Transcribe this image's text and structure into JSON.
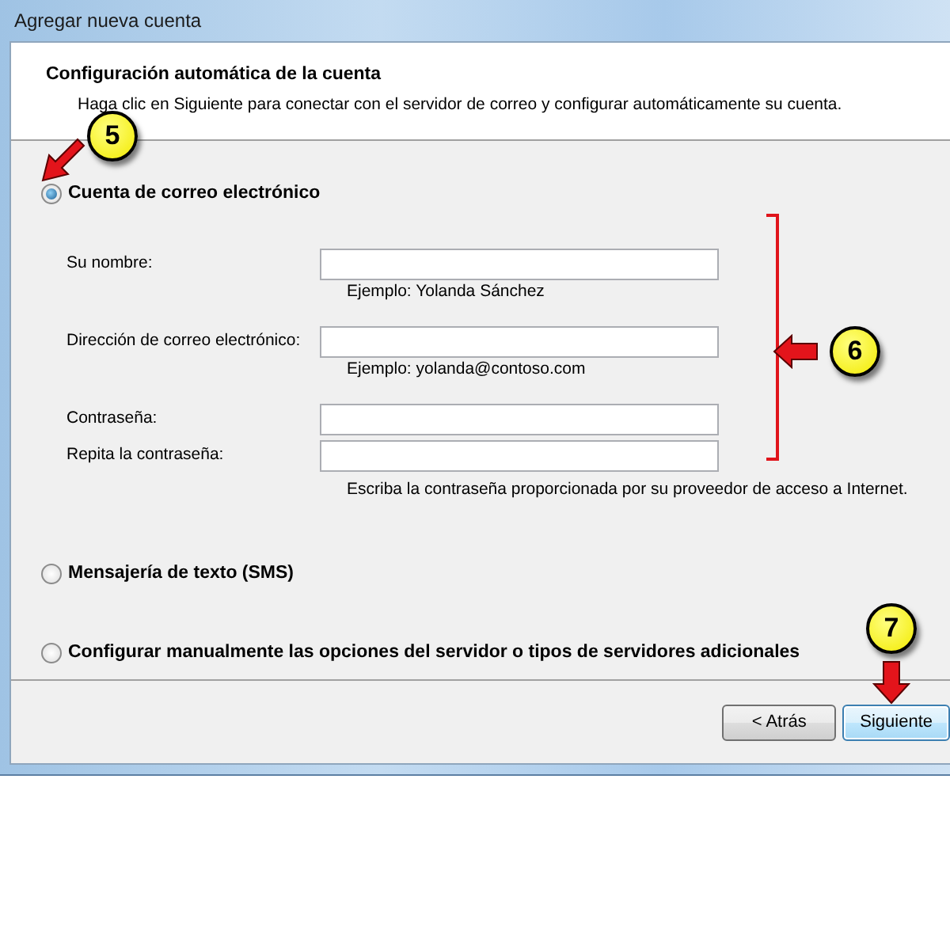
{
  "window": {
    "title": "Agregar nueva cuenta"
  },
  "header": {
    "title": "Configuración automática de la cuenta",
    "subtitle": "Haga clic en Siguiente para conectar con el servidor de correo y configurar automáticamente su cuenta."
  },
  "options": [
    {
      "label": "Cuenta de correo electrónico",
      "selected": true,
      "fields": [
        {
          "label": "Su nombre:",
          "hint": "Ejemplo: Yolanda Sánchez"
        },
        {
          "label": "Dirección de correo electrónico:",
          "hint": "Ejemplo: yolanda@contoso.com"
        },
        {
          "label": "Contraseña:"
        },
        {
          "label": "Repita la contraseña:",
          "hint": "Escriba la contraseña proporcionada por su proveedor de acceso a Internet."
        }
      ]
    },
    {
      "label": "Mensajería de texto (SMS)",
      "selected": false
    },
    {
      "label": "Configurar manualmente las opciones del servidor o tipos de servidores adicionales",
      "selected": false
    }
  ],
  "buttons": [
    {
      "label": "< Atrás",
      "focused": false
    },
    {
      "label": "Siguiente",
      "focused": true
    }
  ],
  "callouts": [
    {
      "number": "5"
    },
    {
      "number": "6"
    },
    {
      "number": "7"
    }
  ]
}
